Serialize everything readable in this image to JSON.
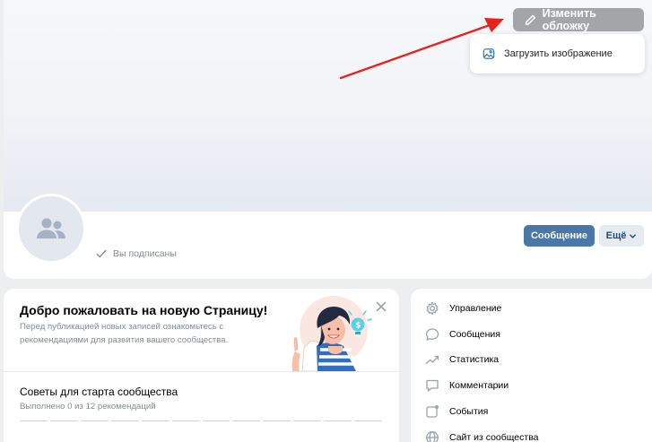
{
  "cover": {
    "change_button_label": "Изменить обложку",
    "dropdown_item_label": "Загрузить изображение"
  },
  "profile": {
    "subscribed_label": "Вы подписаны",
    "message_button_label": "Сообщение",
    "more_button_label": "Ещё"
  },
  "welcome": {
    "title": "Добро пожаловать на новую Страницу!",
    "description": "Перед публикацией новых записей ознакомьтесь с рекомендациями для развития вашего сообщества.",
    "tips_title": "Советы для старта сообщества",
    "tips_progress": "Выполнено 0 из 12 рекомендаций",
    "tips_done": 0,
    "tips_total": 12
  },
  "menu": {
    "items": [
      {
        "label": "Управление",
        "icon": "gear-icon"
      },
      {
        "label": "Сообщения",
        "icon": "message-icon"
      },
      {
        "label": "Статистика",
        "icon": "chart-icon"
      },
      {
        "label": "Комментарии",
        "icon": "comment-icon"
      },
      {
        "label": "События",
        "icon": "event-icon"
      },
      {
        "label": "Сайт из сообщества",
        "icon": "globe-icon"
      }
    ]
  },
  "colors": {
    "primary": "#4a76a8",
    "secondary_button_bg": "#e5ebf1",
    "muted_text": "#818c99",
    "annotation_arrow": "#e8211c"
  }
}
